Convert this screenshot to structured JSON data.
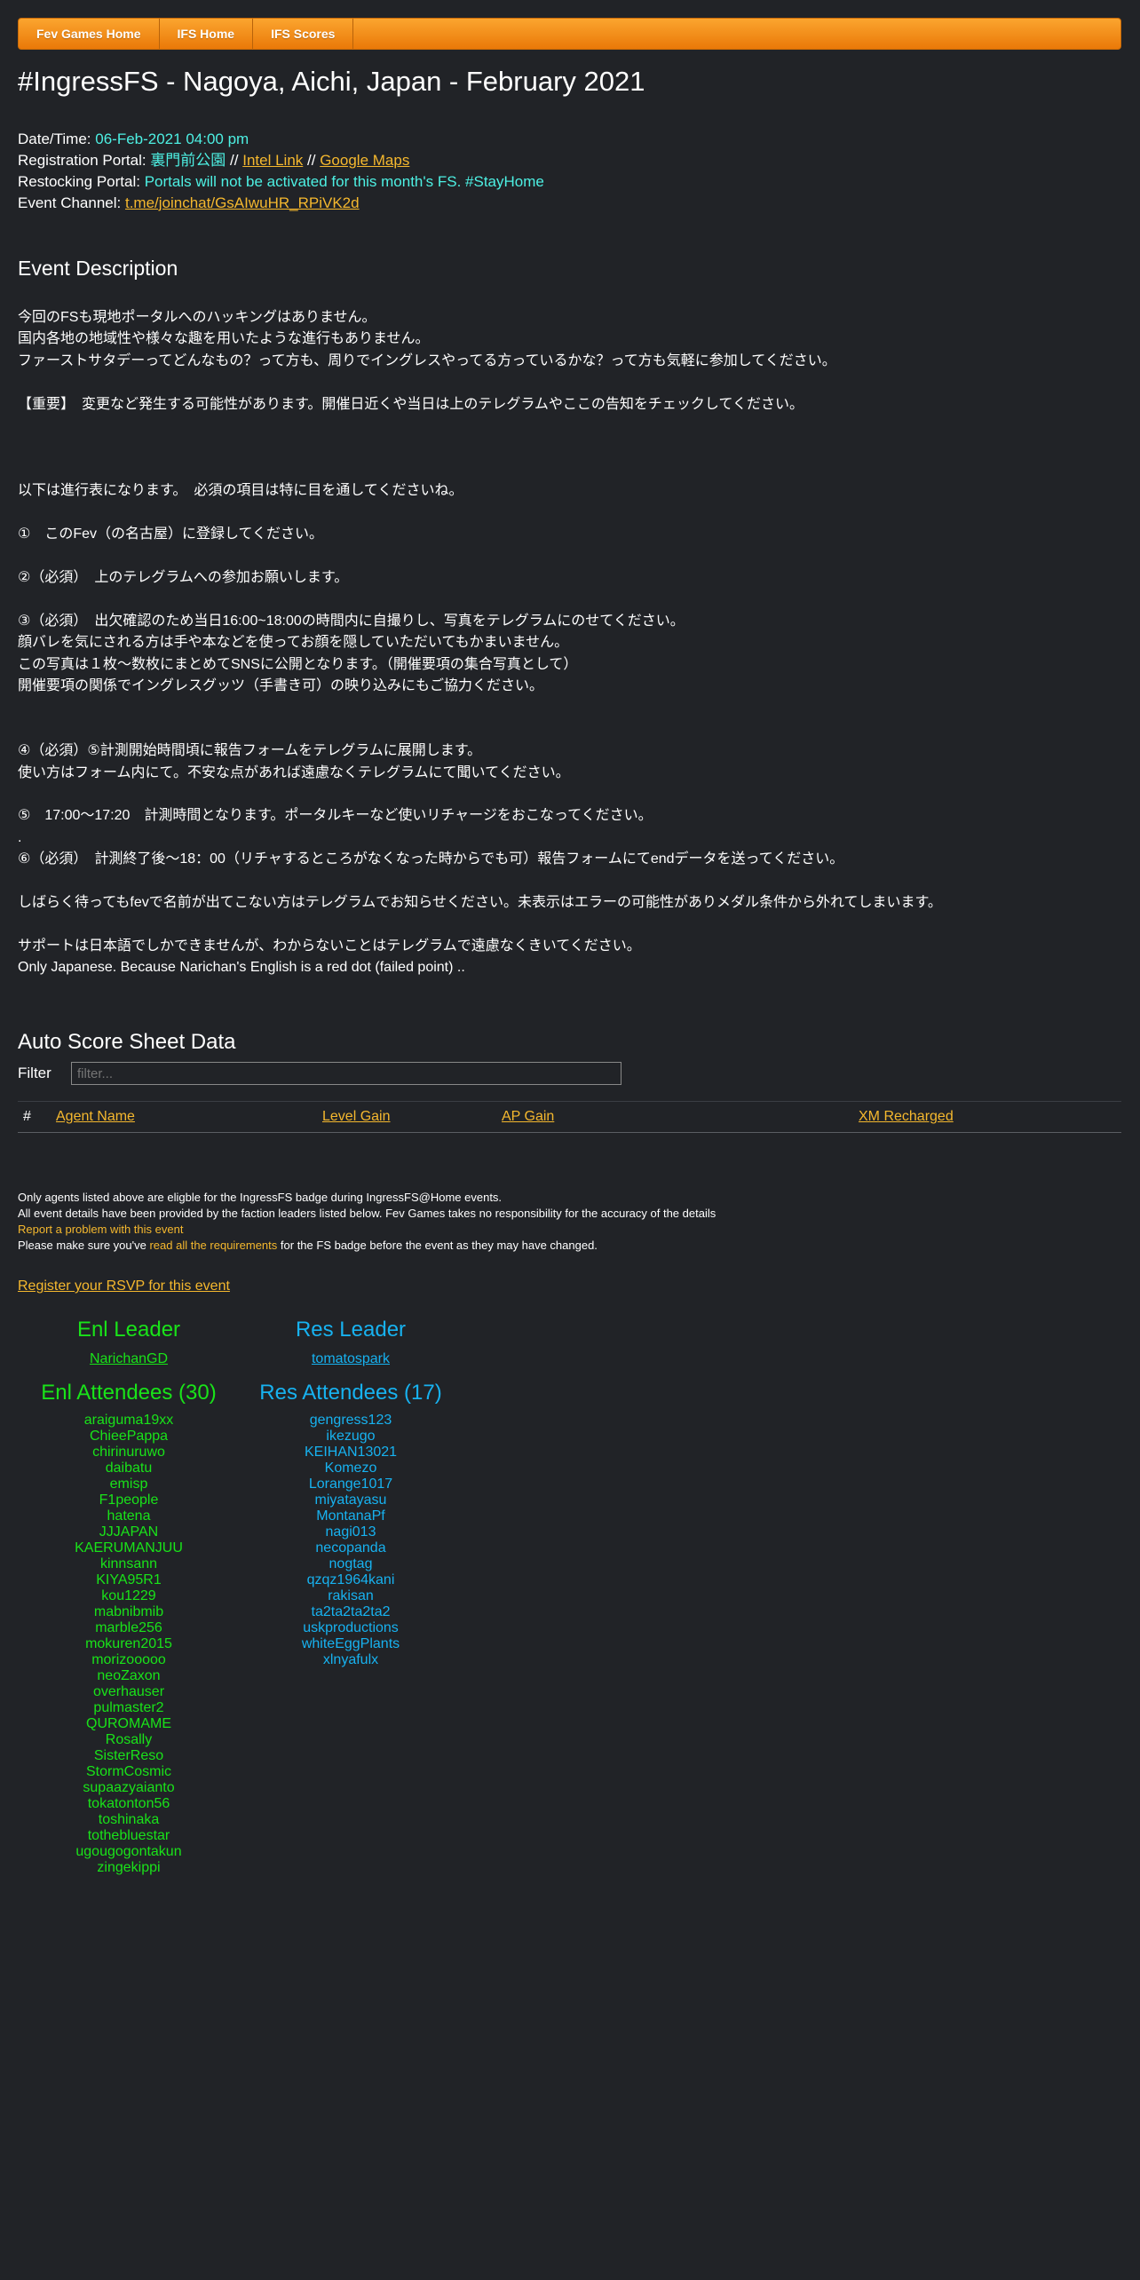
{
  "nav": {
    "items": [
      "Fev Games Home",
      "IFS Home",
      "IFS Scores"
    ]
  },
  "page_title": "#IngressFS - Nagoya, Aichi, Japan - February 2021",
  "meta": {
    "datetime_label": "Date/Time:",
    "datetime_value": "06-Feb-2021 04:00 pm",
    "registration_label": "Registration Portal:",
    "registration_value": "裏門前公園",
    "sep1": "//",
    "intel_link": "Intel Link",
    "sep2": "//",
    "maps_link": "Google Maps",
    "restocking_label": "Restocking Portal:",
    "restocking_value": "Portals will not be activated for this month's FS. #StayHome",
    "channel_label": "Event Channel:",
    "channel_value": "t.me/joinchat/GsAIwuHR_RPiVK2d"
  },
  "description": {
    "title": "Event Description",
    "text": "今回のFSも現地ポータルへのハッキングはありません。\n国内各地の地域性や様々な趣を用いたような進行もありません。\nファーストサタデーってどんなもの？って方も、周りでイングレスやってる方っているかな？って方も気軽に参加してください。\n\n【重要】　変更など発生する可能性があります。開催日近くや当日は上のテレグラムやここの告知をチェックしてください。\n\n\n\n以下は進行表になります。　必須の項目は特に目を通してくださいね。\n\n①　このFev（の名古屋）に登録してください。\n\n②（必須）　上のテレグラムへの参加お願いします。\n\n③（必須）　出欠確認のため当日16:00~18:00の時間内に自撮りし、写真をテレグラムにのせてください。\n顔バレを気にされる方は手や本などを使ってお顔を隠していただいてもかまいません。\nこの写真は１枚～数枚にまとめてSNSに公開となります。（開催要項の集合写真として）\n開催要項の関係でイングレスグッツ（手書き可）の映り込みにもご協力ください。\n\n\n④（必須）⑤計測開始時間頃に報告フォームをテレグラムに展開します。\n使い方はフォーム内にて。不安な点があれば遠慮なくテレグラムにて聞いてください。\n\n⑤　17:00～17:20　計測時間となります。ポータルキーなど使いリチャージをおこなってください。\n.\n⑥（必須）　計測終了後～18：00（リチャするところがなくなった時からでも可）報告フォームにてendデータを送ってください。\n\nしばらく待ってもfevで名前が出てこない方はテレグラムでお知らせください。未表示はエラーの可能性がありメダル条件から外れてしまいます。\n\nサポートは日本語でしかできませんが、わからないことはテレグラムで遠慮なくきいてください。\nOnly Japanese. Because Narichan's English is a red dot (failed point) .."
  },
  "score": {
    "title": "Auto Score Sheet Data",
    "filter_label": "Filter",
    "filter_placeholder": "filter...",
    "columns": [
      "#",
      "Agent Name",
      "Level Gain",
      "AP Gain",
      "XM Recharged"
    ]
  },
  "notes": {
    "line1": "Only agents listed above are eligble for the IngressFS badge during IngressFS@Home events.",
    "line2": "All event details have been provided by the faction leaders listed below. Fev Games takes no responsibility for the accuracy of the details",
    "report_link": "Report a problem with this event",
    "line4_pre": "Please make sure you've",
    "requirements_link": "read all the requirements",
    "line4_post": "for the FS badge before the event as they may have changed."
  },
  "rsvp_link": "Register your RSVP for this event",
  "enl": {
    "leader_title": "Enl Leader",
    "leader_name": "NarichanGD",
    "attendees_title": "Enl Attendees (30)",
    "attendees": [
      "araiguma19xx",
      "ChieePappa",
      "chirinuruwo",
      "daibatu",
      "emisp",
      "F1people",
      "hatena",
      "JJJAPAN",
      "KAERUMANJUU",
      "kinnsann",
      "KIYA95R1",
      "kou1229",
      "mabnibmib",
      "marble256",
      "mokuren2015",
      "morizooooo",
      "neoZaxon",
      "overhauser",
      "pulmaster2",
      "QUROMAME",
      "Rosally",
      "SisterReso",
      "StormCosmic",
      "supaazyaianto",
      "tokatonton56",
      "toshinaka",
      "tothebluestar",
      "ugougogontakun",
      "zingekippi"
    ],
    "color": "#19e319"
  },
  "res": {
    "leader_title": "Res Leader",
    "leader_name": "tomatospark",
    "attendees_title": "Res Attendees (17)",
    "attendees": [
      "gengress123",
      "ikezugo",
      "KEIHAN13021",
      "Komezo",
      "Lorange1017",
      "miyatayasu",
      "MontanaPf",
      "nagi013",
      "necopanda",
      "nogtag",
      "qzqz1964kani",
      "rakisan",
      "ta2ta2ta2ta2",
      "uskproductions",
      "whiteEggPlants",
      "xlnyafulx"
    ],
    "color": "#17b2f0"
  },
  "colors": {
    "background": "#212327",
    "nav_orange": "#f28a1a",
    "link_yellow": "#f5b82e",
    "cyan": "#4df0e3"
  }
}
